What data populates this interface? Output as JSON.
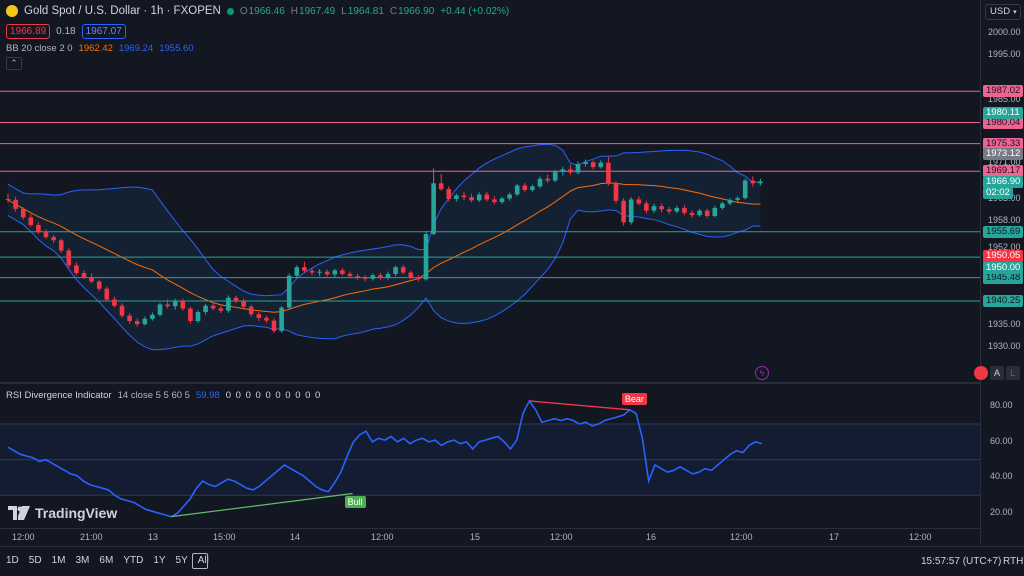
{
  "header": {
    "symbol": "Gold Spot / U.S. Dollar · 1h · FXOPEN",
    "ohlc": {
      "o_key": "O",
      "o": "1966.46",
      "h_key": "H",
      "h": "1967.49",
      "l_key": "L",
      "l": "1964.81",
      "c_key": "C",
      "c": "1966.90",
      "change": "+0.44 (+0.02%)"
    },
    "bid": "1966.89",
    "spread": "0.18",
    "ask": "1967.07",
    "bb_label": "BB 20 close 2 0",
    "bb_basis": "1962.42",
    "bb_upper": "1969.24",
    "bb_lower": "1955.60",
    "currency": "USD"
  },
  "indicator": {
    "label": "RSI Divergence Indicator",
    "params": "14 close 5 5 60 5",
    "value": "59.98",
    "zeros": "0 0 0 0 0 0 0 0 0 0",
    "bear_label": "Bear",
    "bull_label": "Bull"
  },
  "price_axis": {
    "ticks": [
      "2000.00",
      "1995.00",
      "1985.00",
      "1980.00",
      "1975.00",
      "1971.00",
      "1963.00",
      "1958.00",
      "1952.00",
      "1945.00",
      "1940.00",
      "1935.00",
      "1930.00"
    ]
  },
  "price_lines": [
    {
      "value": "1987.02",
      "color": "#f06292"
    },
    {
      "value": "1980.04",
      "color": "#f06292"
    },
    {
      "value": "1975.33",
      "color": "#f06292"
    },
    {
      "value": "1969.17",
      "color": "#f06292"
    },
    {
      "value": "1955.69",
      "color": "#26a69a"
    },
    {
      "value": "1950.05",
      "color": "#26a69a"
    },
    {
      "value": "1945.48",
      "color": "#26a69a"
    },
    {
      "value": "1940.25",
      "color": "#26a69a"
    }
  ],
  "axis_badges": [
    {
      "value": "1980.11",
      "color": "#26a69a"
    },
    {
      "value": "1973.12",
      "color": "#787b86"
    },
    {
      "value": "1966.90",
      "color": "#26a69a"
    },
    {
      "value": "02:02",
      "color": "#26a69a"
    },
    {
      "value": "1950.05",
      "color": "#f23645"
    },
    {
      "value": "1950.00",
      "color": "#26a69a"
    }
  ],
  "rsi_axis": {
    "ticks": [
      "80.00",
      "60.00",
      "40.00",
      "20.00"
    ]
  },
  "time_axis": {
    "ticks": [
      "12:00",
      "21:00",
      "13",
      "15:00",
      "14",
      "12:00",
      "15",
      "12:00",
      "16",
      "12:00",
      "17",
      "12:00"
    ]
  },
  "footer": {
    "ranges": [
      "1D",
      "5D",
      "1M",
      "3M",
      "6M",
      "YTD",
      "1Y",
      "5Y",
      "All"
    ],
    "time": "15:57:57 (UTC+7)",
    "rth": "RTH"
  },
  "logo_text": "TradingView",
  "pane_buttons": {
    "auto": "A",
    "log": "L"
  },
  "colors": {
    "bg": "#131722",
    "up": "#26a69a",
    "down": "#f23645",
    "bb_band": "#2962ff",
    "bb_basis": "#ff6d00",
    "rsi": "#2962ff",
    "text": "#d1d4dc",
    "axis_text": "#b2b5be"
  },
  "chart_data": {
    "type": "candlestick",
    "title": "Gold Spot / U.S. Dollar · 1h · FXOPEN",
    "ylim": [
      1926,
      2004
    ],
    "x_ticks": [
      "12:00",
      "21:00",
      "13",
      "15:00",
      "14",
      "12:00",
      "15",
      "12:00",
      "16",
      "12:00",
      "17",
      "12:00"
    ],
    "candles": [
      [
        1963.0,
        1964.2,
        1962.2,
        1962.8
      ],
      [
        1962.8,
        1963.5,
        1960.2,
        1960.8
      ],
      [
        1960.8,
        1961.2,
        1958.4,
        1958.9
      ],
      [
        1958.9,
        1959.6,
        1956.8,
        1957.2
      ],
      [
        1957.2,
        1957.8,
        1955.2,
        1955.6
      ],
      [
        1955.6,
        1956.2,
        1954.1,
        1954.5
      ],
      [
        1954.5,
        1955.0,
        1953.2,
        1953.8
      ],
      [
        1953.8,
        1954.2,
        1951.0,
        1951.5
      ],
      [
        1951.5,
        1952.0,
        1947.5,
        1948.2
      ],
      [
        1948.2,
        1948.8,
        1946.0,
        1946.5
      ],
      [
        1946.5,
        1947.1,
        1945.2,
        1945.6
      ],
      [
        1945.6,
        1946.4,
        1944.2,
        1944.6
      ],
      [
        1944.6,
        1945.0,
        1942.5,
        1943.0
      ],
      [
        1943.0,
        1943.5,
        1940.2,
        1940.6
      ],
      [
        1940.6,
        1941.2,
        1938.8,
        1939.2
      ],
      [
        1939.2,
        1939.8,
        1936.5,
        1937.0
      ],
      [
        1937.0,
        1937.5,
        1935.2,
        1935.8
      ],
      [
        1935.8,
        1936.4,
        1934.5,
        1935.1
      ],
      [
        1935.1,
        1936.8,
        1934.8,
        1936.3
      ],
      [
        1936.3,
        1937.7,
        1935.9,
        1937.2
      ],
      [
        1937.2,
        1939.9,
        1936.8,
        1939.5
      ],
      [
        1939.5,
        1940.6,
        1938.6,
        1939.1
      ],
      [
        1939.1,
        1940.8,
        1938.3,
        1940.3
      ],
      [
        1940.3,
        1940.8,
        1938.1,
        1938.6
      ],
      [
        1938.6,
        1939.0,
        1935.2,
        1935.8
      ],
      [
        1935.8,
        1938.2,
        1935.4,
        1937.8
      ],
      [
        1937.8,
        1939.6,
        1937.2,
        1939.2
      ],
      [
        1939.2,
        1940.0,
        1938.2,
        1938.6
      ],
      [
        1938.6,
        1939.1,
        1937.6,
        1938.1
      ],
      [
        1938.1,
        1941.5,
        1937.6,
        1941.0
      ],
      [
        1941.0,
        1941.4,
        1939.8,
        1940.3
      ],
      [
        1940.3,
        1940.8,
        1938.4,
        1939.0
      ],
      [
        1939.0,
        1939.4,
        1936.8,
        1937.3
      ],
      [
        1937.3,
        1937.8,
        1935.8,
        1936.5
      ],
      [
        1936.5,
        1937.0,
        1935.4,
        1935.9
      ],
      [
        1935.9,
        1936.4,
        1933.1,
        1933.6
      ],
      [
        1933.6,
        1939.2,
        1933.2,
        1938.8
      ],
      [
        1938.8,
        1946.4,
        1938.3,
        1945.9
      ],
      [
        1945.9,
        1948.2,
        1945.5,
        1947.8
      ],
      [
        1947.8,
        1949.0,
        1946.6,
        1947.0
      ],
      [
        1947.0,
        1947.6,
        1946.0,
        1946.6
      ],
      [
        1946.6,
        1947.4,
        1945.8,
        1946.8
      ],
      [
        1946.8,
        1947.3,
        1945.7,
        1946.2
      ],
      [
        1946.2,
        1947.5,
        1945.6,
        1947.1
      ],
      [
        1947.1,
        1947.6,
        1945.9,
        1946.3
      ],
      [
        1946.3,
        1946.8,
        1945.3,
        1945.8
      ],
      [
        1945.8,
        1946.3,
        1945.0,
        1945.5
      ],
      [
        1945.5,
        1946.0,
        1944.6,
        1945.2
      ],
      [
        1945.2,
        1946.4,
        1944.8,
        1946.0
      ],
      [
        1946.0,
        1946.5,
        1945.0,
        1945.4
      ],
      [
        1945.4,
        1946.8,
        1945.0,
        1946.3
      ],
      [
        1946.3,
        1948.2,
        1945.8,
        1947.8
      ],
      [
        1947.8,
        1948.3,
        1946.2,
        1946.6
      ],
      [
        1946.6,
        1947.0,
        1945.1,
        1945.5
      ],
      [
        1945.5,
        1946.0,
        1944.6,
        1945.1
      ],
      [
        1945.1,
        1955.8,
        1944.8,
        1955.2
      ],
      [
        1955.2,
        1969.8,
        1954.9,
        1966.5
      ],
      [
        1966.5,
        1968.6,
        1964.8,
        1965.2
      ],
      [
        1965.2,
        1965.8,
        1962.5,
        1963.0
      ],
      [
        1963.0,
        1964.2,
        1962.4,
        1963.8
      ],
      [
        1963.8,
        1964.6,
        1962.8,
        1963.4
      ],
      [
        1963.4,
        1964.2,
        1962.2,
        1962.7
      ],
      [
        1962.7,
        1964.5,
        1962.3,
        1964.0
      ],
      [
        1964.0,
        1964.6,
        1962.4,
        1962.9
      ],
      [
        1962.9,
        1963.6,
        1961.8,
        1962.3
      ],
      [
        1962.3,
        1963.5,
        1961.9,
        1963.1
      ],
      [
        1963.1,
        1964.4,
        1962.6,
        1964.0
      ],
      [
        1964.0,
        1966.4,
        1963.6,
        1966.0
      ],
      [
        1966.0,
        1966.6,
        1964.5,
        1965.0
      ],
      [
        1965.0,
        1966.2,
        1964.6,
        1965.8
      ],
      [
        1965.8,
        1968.0,
        1965.4,
        1967.5
      ],
      [
        1967.5,
        1968.4,
        1966.6,
        1967.1
      ],
      [
        1967.1,
        1969.5,
        1966.8,
        1969.0
      ],
      [
        1969.0,
        1970.2,
        1968.2,
        1969.6
      ],
      [
        1969.6,
        1970.6,
        1968.4,
        1968.9
      ],
      [
        1968.9,
        1971.4,
        1968.5,
        1970.8
      ],
      [
        1970.8,
        1971.8,
        1970.2,
        1971.2
      ],
      [
        1971.2,
        1971.6,
        1969.6,
        1970.1
      ],
      [
        1970.1,
        1971.6,
        1969.8,
        1971.1
      ],
      [
        1971.1,
        1972.4,
        1966.0,
        1966.5
      ],
      [
        1966.5,
        1966.9,
        1962.0,
        1962.6
      ],
      [
        1962.6,
        1963.2,
        1957.0,
        1957.8
      ],
      [
        1957.8,
        1963.4,
        1957.3,
        1962.9
      ],
      [
        1962.9,
        1963.6,
        1961.6,
        1962.0
      ],
      [
        1962.0,
        1962.6,
        1959.8,
        1960.4
      ],
      [
        1960.4,
        1961.9,
        1959.9,
        1961.4
      ],
      [
        1961.4,
        1962.0,
        1960.0,
        1960.7
      ],
      [
        1960.7,
        1961.2,
        1959.6,
        1960.2
      ],
      [
        1960.2,
        1961.5,
        1959.8,
        1961.0
      ],
      [
        1961.0,
        1961.6,
        1959.4,
        1959.9
      ],
      [
        1959.9,
        1960.4,
        1958.8,
        1959.4
      ],
      [
        1959.4,
        1960.8,
        1959.0,
        1960.4
      ],
      [
        1960.4,
        1960.8,
        1958.7,
        1959.2
      ],
      [
        1959.2,
        1961.5,
        1958.9,
        1961.0
      ],
      [
        1961.0,
        1962.4,
        1960.6,
        1962.0
      ],
      [
        1962.0,
        1963.2,
        1961.6,
        1962.8
      ],
      [
        1962.8,
        1963.6,
        1962.2,
        1963.2
      ],
      [
        1963.2,
        1967.6,
        1962.9,
        1967.1
      ],
      [
        1967.1,
        1968.0,
        1965.8,
        1966.5
      ],
      [
        1966.5,
        1967.5,
        1966.0,
        1966.9
      ]
    ],
    "rsi": [
      57,
      55,
      53,
      52,
      51,
      49,
      50,
      48,
      46,
      44,
      42,
      41,
      38,
      36,
      35,
      34,
      33,
      30,
      28,
      27,
      26,
      24,
      22,
      21,
      20,
      19,
      18,
      20,
      24,
      28,
      34,
      38,
      36,
      35,
      37,
      39,
      38,
      36,
      34,
      33,
      35,
      38,
      41,
      44,
      47,
      45,
      43,
      41,
      38,
      35,
      33,
      32,
      37,
      43,
      52,
      60,
      64,
      66,
      60,
      62,
      61,
      63,
      60,
      62,
      59,
      61,
      62,
      60,
      61,
      58,
      60,
      61,
      59,
      60,
      56,
      60,
      61,
      62,
      63,
      60,
      56,
      61,
      76,
      83,
      78,
      71,
      72,
      73,
      72,
      73,
      72,
      70,
      71,
      69,
      70,
      72,
      73,
      74,
      75,
      78,
      76,
      62,
      38,
      47,
      45,
      43,
      44,
      46,
      44,
      42,
      43,
      45,
      44,
      47,
      50,
      53,
      55,
      54,
      58,
      60,
      59
    ],
    "rsi_ylim": [
      15,
      88
    ]
  }
}
